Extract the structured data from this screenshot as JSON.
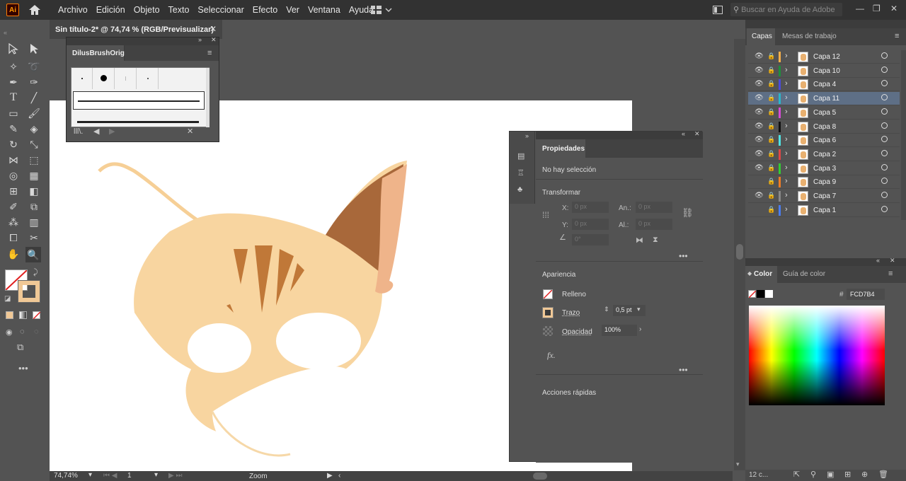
{
  "app": {
    "logo": "Ai",
    "home_icon": "home-icon"
  },
  "menu": [
    "Archivo",
    "Edición",
    "Objeto",
    "Texto",
    "Seleccionar",
    "Efecto",
    "Ver",
    "Ventana",
    "Ayuda"
  ],
  "search": {
    "placeholder": "Buscar en Ayuda de Adobe"
  },
  "document_tab": {
    "title": "Sin título-2* @ 74,74 % (RGB/Previsualizar)"
  },
  "brush_panel": {
    "title": "DilusBrushOrig"
  },
  "properties": {
    "tab": "Propiedades",
    "selection": "No hay selección",
    "transform": "Transformar",
    "x_label": "X:",
    "x_value": "0 px",
    "y_label": "Y:",
    "y_value": "0 px",
    "w_label": "An.:",
    "w_value": "0 px",
    "h_label": "Al.:",
    "h_value": "0 px",
    "angle_value": "0°",
    "appearance": "Apariencia",
    "fill": "Relleno",
    "stroke": "Trazo",
    "stroke_value": "0,5 pt",
    "opacity": "Opacidad",
    "opacity_value": "100%",
    "fx": "fx.",
    "quick_actions": "Acciones rápidas"
  },
  "layers_panel": {
    "tabs": [
      "Capas",
      "Mesas de trabajo"
    ],
    "rows": [
      {
        "name": "Capa 12",
        "color": "#f7b04a",
        "visible": true,
        "selected": false
      },
      {
        "name": "Capa 10",
        "color": "#1f8f3c",
        "visible": true,
        "selected": false
      },
      {
        "name": "Capa 4",
        "color": "#4b4bdc",
        "visible": true,
        "selected": false
      },
      {
        "name": "Capa 11",
        "color": "#2bb6c9",
        "visible": true,
        "selected": true
      },
      {
        "name": "Capa 5",
        "color": "#d64bd6",
        "visible": true,
        "selected": false
      },
      {
        "name": "Capa 8",
        "color": "#111111",
        "visible": true,
        "selected": false
      },
      {
        "name": "Capa 6",
        "color": "#4fe3e3",
        "visible": true,
        "selected": false
      },
      {
        "name": "Capa 2",
        "color": "#e04646",
        "visible": true,
        "selected": false
      },
      {
        "name": "Capa 3",
        "color": "#33cc33",
        "visible": true,
        "selected": false
      },
      {
        "name": "Capa 9",
        "color": "#f07c24",
        "visible": false,
        "selected": false
      },
      {
        "name": "Capa 7",
        "color": "#888888",
        "visible": true,
        "selected": false
      },
      {
        "name": "Capa 1",
        "color": "#4a7cf0",
        "visible": false,
        "selected": false
      }
    ],
    "count": "12 c..."
  },
  "color_panel": {
    "tabs": [
      "Color",
      "Guía de color"
    ],
    "hex_label": "#",
    "hex_value": "FCD7B4"
  },
  "status": {
    "zoom": "74,74%",
    "page": "1",
    "tool": "Zoom"
  },
  "colors": {
    "fill": "#ffffff",
    "stroke": "#fcd7b4",
    "accent": "#5e6f86"
  }
}
